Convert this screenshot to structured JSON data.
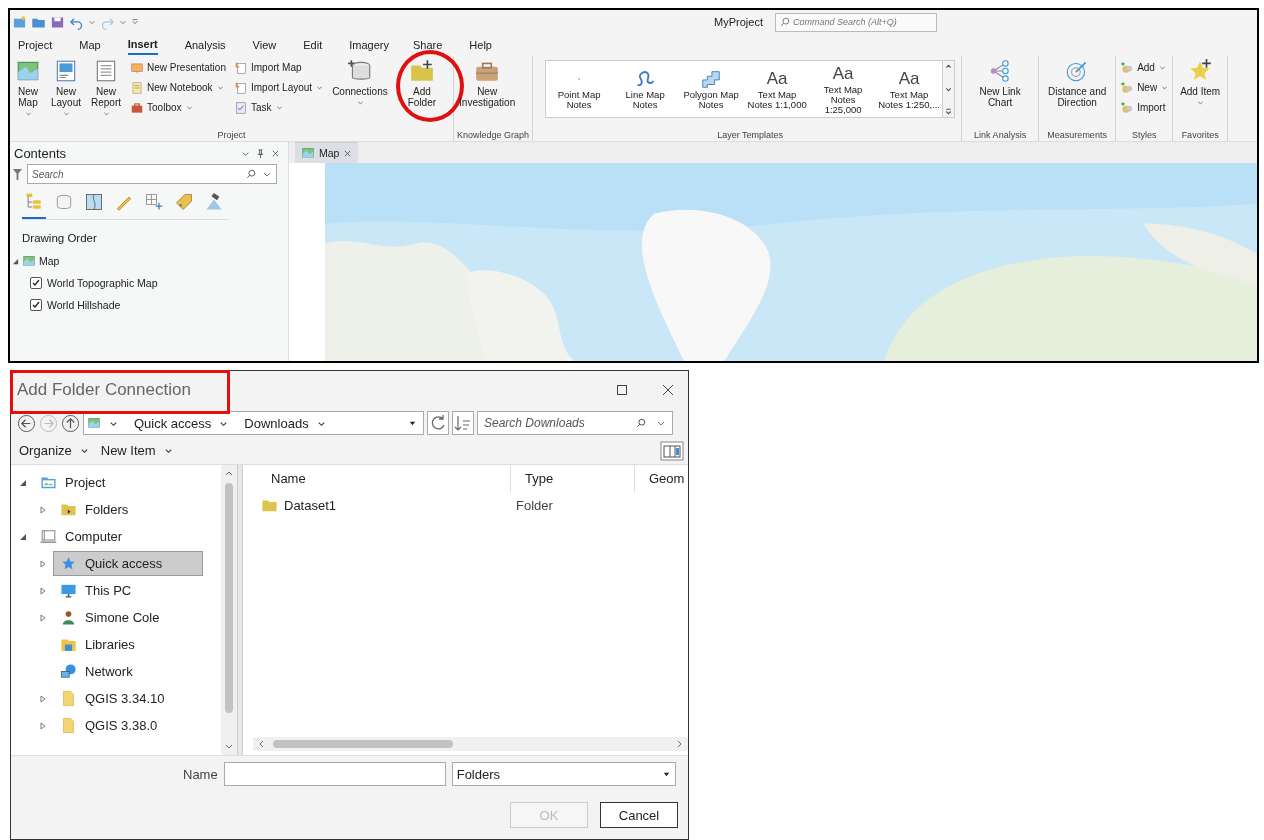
{
  "app": {
    "title": "MyProject",
    "command_search": {
      "placeholder": "Command Search (Alt+Q)"
    },
    "ribbon_tabs": [
      {
        "label": "Project",
        "selected": false
      },
      {
        "label": "Map",
        "selected": false
      },
      {
        "label": "Insert",
        "selected": true
      },
      {
        "label": "Analysis",
        "selected": false
      },
      {
        "label": "View",
        "selected": false
      },
      {
        "label": "Edit",
        "selected": false
      },
      {
        "label": "Imagery",
        "selected": false
      },
      {
        "label": "Share",
        "selected": false
      },
      {
        "label": "Help",
        "selected": false
      }
    ],
    "ribbon_groups": [
      {
        "label": "Project",
        "items": [
          {
            "kind": "large",
            "label": "New Map",
            "dropdown": true
          },
          {
            "kind": "large",
            "label": "New Layout",
            "dropdown": true
          },
          {
            "kind": "large",
            "label": "New Report",
            "dropdown": true
          },
          {
            "kind": "stack",
            "items": [
              {
                "label": "New Presentation",
                "dropdown": false
              },
              {
                "label": "New Notebook",
                "dropdown": true
              },
              {
                "label": "Toolbox",
                "dropdown": true
              }
            ]
          },
          {
            "kind": "stack",
            "items": [
              {
                "label": "Import Map",
                "dropdown": false
              },
              {
                "label": "Import Layout",
                "dropdown": true
              },
              {
                "label": "Task",
                "dropdown": true
              }
            ]
          },
          {
            "kind": "large",
            "label": "Connections",
            "dropdown": true
          },
          {
            "kind": "large",
            "label": "Add Folder",
            "dropdown": false
          }
        ]
      },
      {
        "label": "Knowledge Graph",
        "items": [
          {
            "kind": "large",
            "label": "New Investigation",
            "dropdown": false
          }
        ]
      },
      {
        "label": "Layer Templates",
        "items": [
          {
            "kind": "gallery",
            "items": [
              {
                "label": "Point Map Notes"
              },
              {
                "label": "Line Map Notes"
              },
              {
                "label": "Polygon Map Notes"
              },
              {
                "label": "Text Map Notes 1:1,000",
                "glyph": "Aa"
              },
              {
                "label": "Text Map Notes 1:25,000",
                "glyph": "Aa"
              },
              {
                "label": "Text Map Notes 1:250,...",
                "glyph": "Aa"
              }
            ]
          }
        ]
      },
      {
        "label": "Link Analysis",
        "items": [
          {
            "kind": "large",
            "label": "New Link Chart",
            "dropdown": false
          }
        ]
      },
      {
        "label": "Measurements",
        "items": [
          {
            "kind": "large",
            "label": "Distance and Direction",
            "dropdown": false
          }
        ]
      },
      {
        "label": "Styles",
        "items": [
          {
            "kind": "stack",
            "items": [
              {
                "label": "Add",
                "dropdown": true
              },
              {
                "label": "New",
                "dropdown": true
              },
              {
                "label": "Import",
                "dropdown": false
              }
            ]
          }
        ]
      },
      {
        "label": "Favorites",
        "items": [
          {
            "kind": "large",
            "label": "Add Item",
            "dropdown": true
          }
        ]
      }
    ],
    "contents": {
      "title": "Contents",
      "search": {
        "placeholder": "Search"
      },
      "view_tabs": [
        {
          "selected": true
        },
        {
          "selected": false
        },
        {
          "selected": false
        },
        {
          "selected": false
        },
        {
          "selected": false
        },
        {
          "selected": false
        },
        {
          "selected": false
        }
      ],
      "heading": "Drawing Order",
      "tree": [
        {
          "label": "Map",
          "expanded": true,
          "children": [
            {
              "label": "World Topographic Map",
              "checked": true
            },
            {
              "label": "World Hillshade",
              "checked": true
            }
          ]
        }
      ]
    },
    "view_tabs": [
      {
        "label": "Map",
        "selected": true
      }
    ]
  },
  "dialog": {
    "title": "Add Folder Connection",
    "breadcrumb": [
      "Quick access",
      "Downloads"
    ],
    "search": {
      "placeholder": "Search Downloads"
    },
    "toolbar": [
      "Organize",
      "New Item"
    ],
    "tree": [
      {
        "label": "Project",
        "expanded": true,
        "selected": false,
        "children": [
          {
            "label": "Folders",
            "expanded": false,
            "selected": false
          }
        ]
      },
      {
        "label": "Computer",
        "expanded": true,
        "selected": false,
        "children": [
          {
            "label": "Quick access",
            "expanded": false,
            "selected": true
          },
          {
            "label": "This PC",
            "expanded": false,
            "selected": false
          },
          {
            "label": "Simone Cole",
            "expanded": false,
            "selected": false
          },
          {
            "label": "Libraries",
            "selected": false
          },
          {
            "label": "Network",
            "selected": false
          },
          {
            "label": "QGIS 3.34.10",
            "expanded": false,
            "selected": false
          },
          {
            "label": "QGIS 3.38.0",
            "expanded": false,
            "selected": false
          }
        ]
      }
    ],
    "columns": [
      "Name",
      "Type",
      "Geom"
    ],
    "rows": [
      {
        "name": "Dataset1",
        "type": "Folder"
      }
    ],
    "name_field": {
      "label": "Name"
    },
    "filter": {
      "value": "Folders"
    },
    "buttons": [
      {
        "label": "OK",
        "disabled": true
      },
      {
        "label": "Cancel",
        "disabled": false
      }
    ]
  }
}
